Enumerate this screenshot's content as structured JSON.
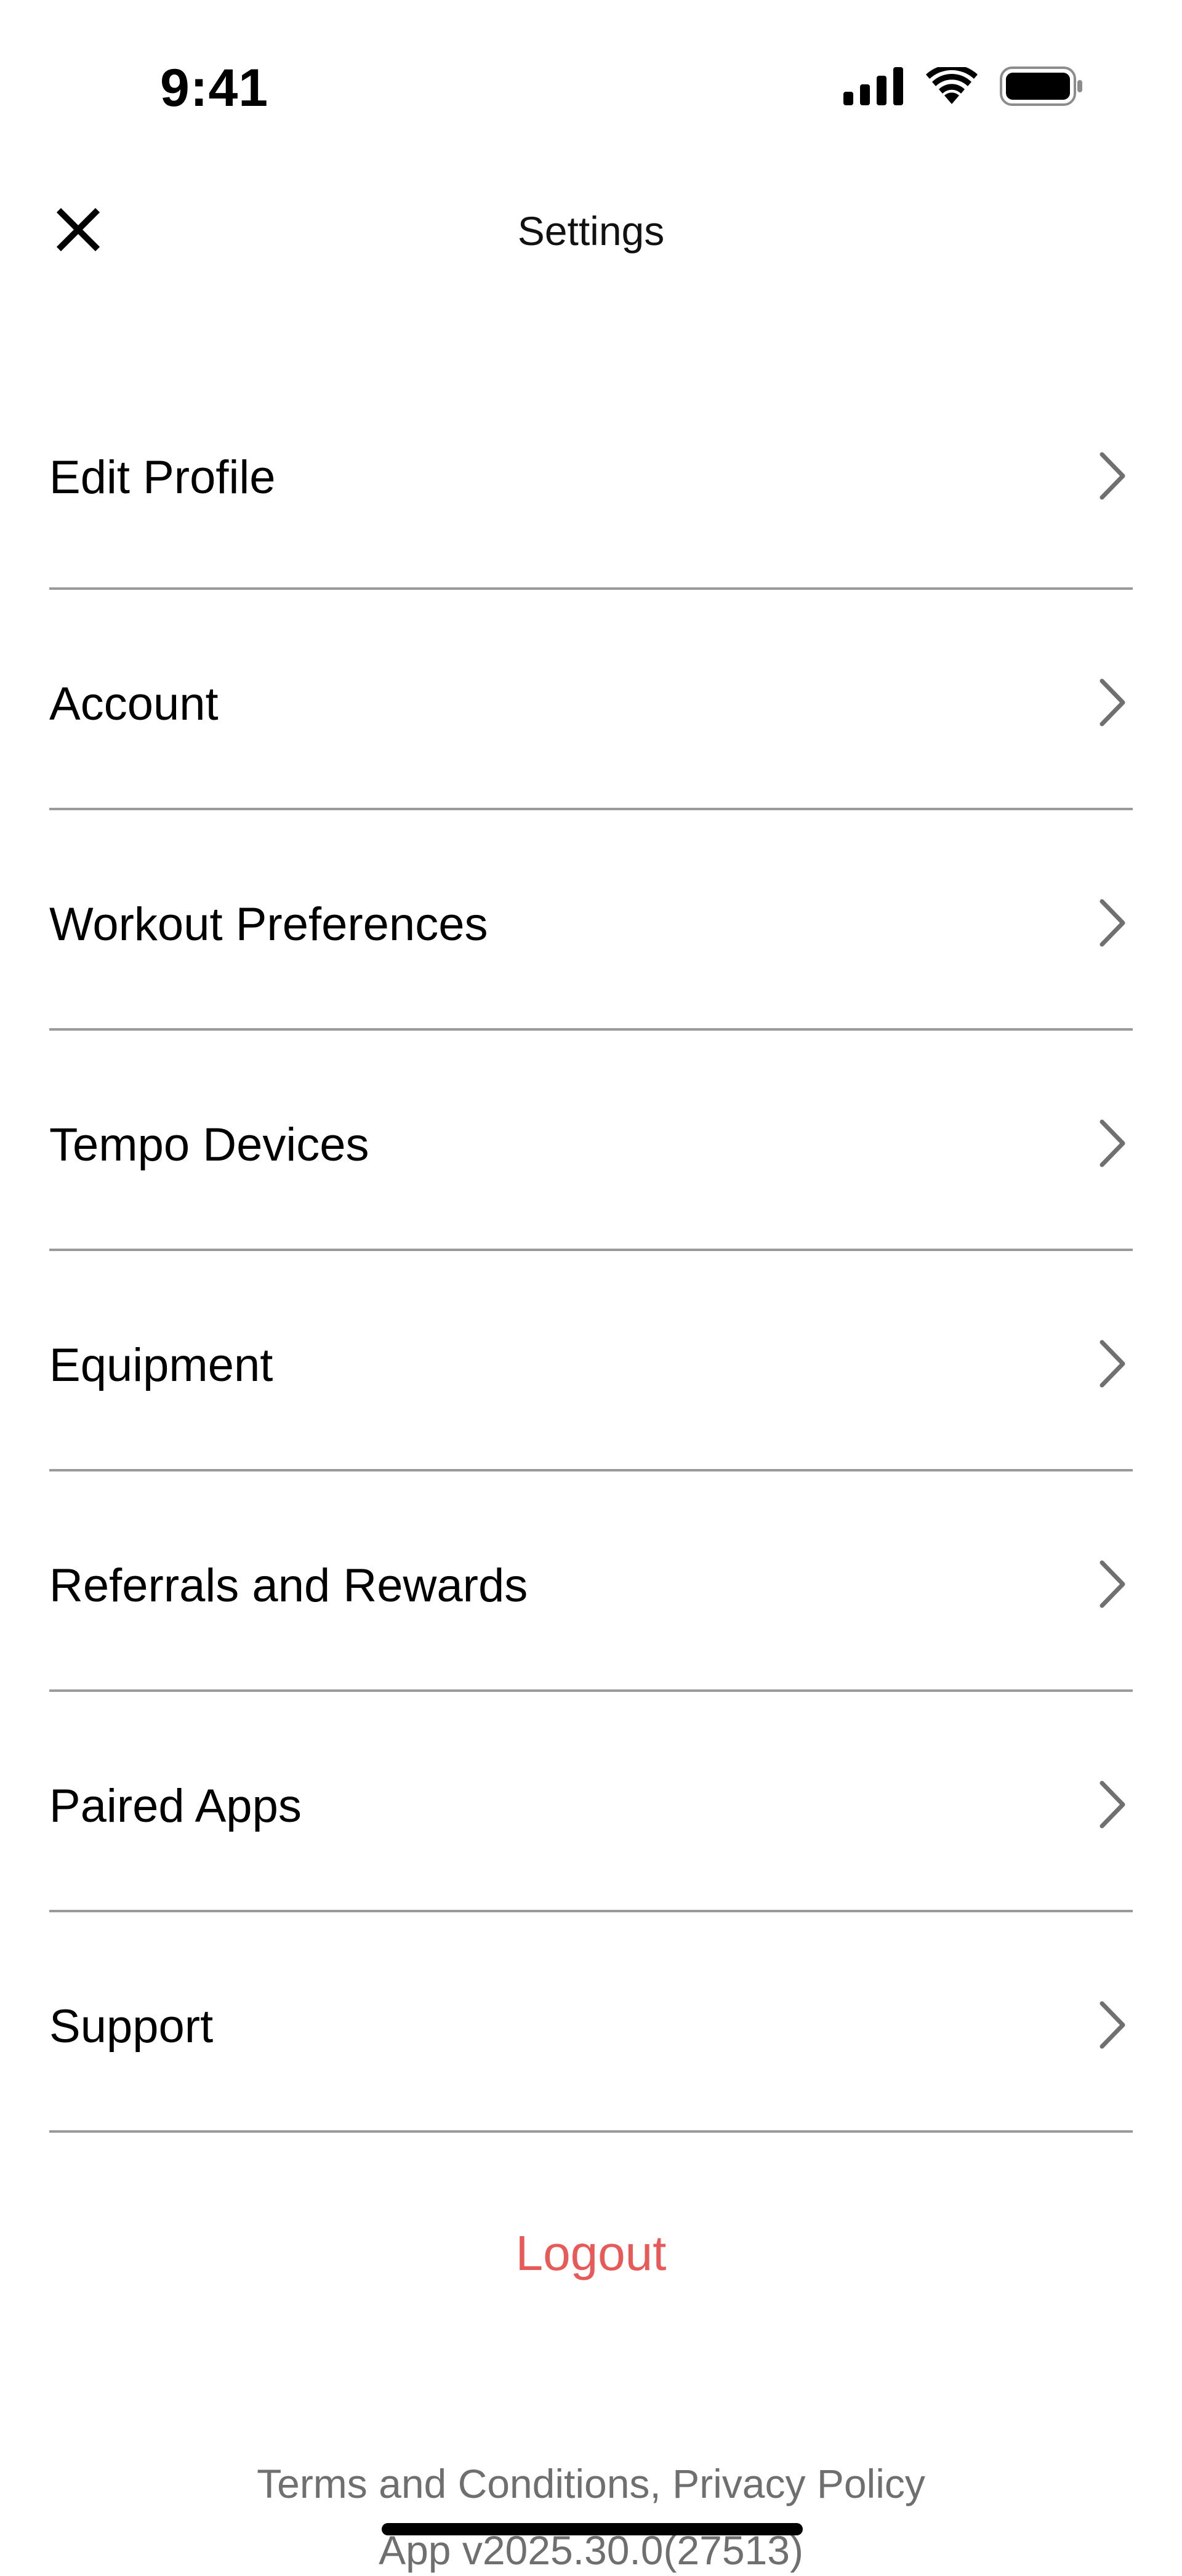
{
  "status_bar": {
    "time": "9:41",
    "icons": [
      "cellular-signal-icon",
      "wifi-icon",
      "battery-icon"
    ]
  },
  "header": {
    "title": "Settings",
    "close_icon": "close-icon"
  },
  "settings": {
    "items": [
      {
        "label": "Edit Profile"
      },
      {
        "label": "Account"
      },
      {
        "label": "Workout Preferences"
      },
      {
        "label": "Tempo Devices"
      },
      {
        "label": "Equipment"
      },
      {
        "label": "Referrals and Rewards"
      },
      {
        "label": "Paired Apps"
      },
      {
        "label": "Support"
      }
    ],
    "chevron_icon": "chevron-right-icon"
  },
  "logout": {
    "label": "Logout",
    "color": "#e85a57"
  },
  "footer": {
    "terms_label": "Terms and Conditions",
    "separator": ", ",
    "privacy_label": "Privacy Policy",
    "version": "App v2025.30.0(27513)"
  },
  "colors": {
    "divider": "#9a9a9a",
    "secondary_text": "#6f6f6f",
    "chevron": "#707070"
  }
}
